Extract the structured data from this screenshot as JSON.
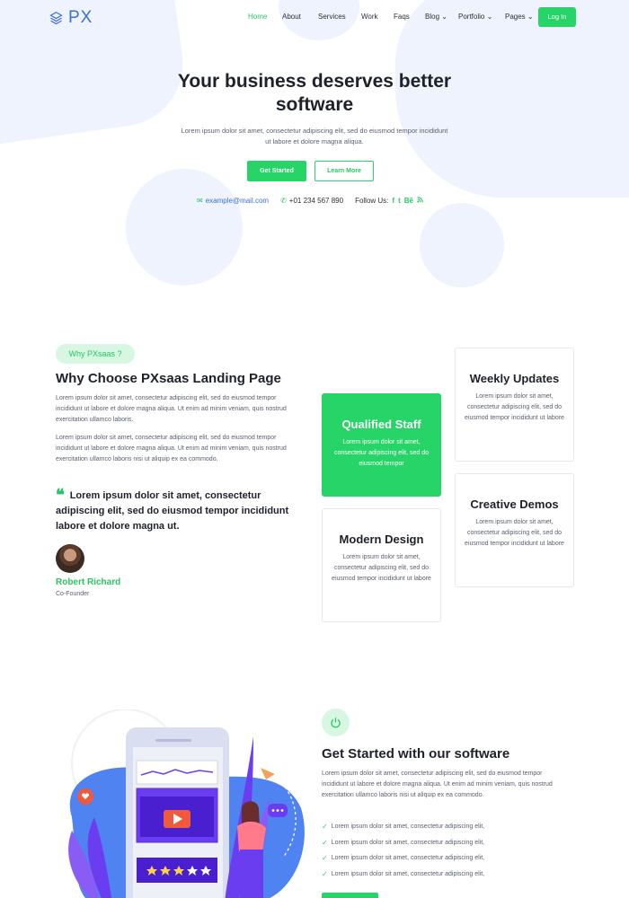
{
  "brand": {
    "logo_text": "PX"
  },
  "nav": {
    "items": [
      "Home",
      "About",
      "Services",
      "Work",
      "Faqs",
      "Blog",
      "Portfolio",
      "Pages"
    ],
    "dropdown_marker": "⌄",
    "login_label": "Log In",
    "active": "Home"
  },
  "hero": {
    "title": "Your business deserves better software",
    "subtitle": "Lorem ipsum dolor sit amet, consectetur adipiscing elit, sed do eiusmod tempor incididunt ut labore et dolore magna aliqua.",
    "primary_button": "Get Started",
    "secondary_button": "Learn More",
    "email": "example@mail.com",
    "phone": "+01 234 567 890",
    "follow_label": "Follow Us:",
    "social": [
      "f",
      "t",
      "Bē",
      "rss"
    ]
  },
  "why": {
    "pill": "Why PXsaas ?",
    "title": "Why Choose PXsaas Landing Page",
    "para1": "Lorem ipsum dolor sit amet, consectetur adipiscing elit, sed do eiusmod tempor incididunt ut labore et dolore magna aliqua. Ut enim ad minim veniam, quis nostrud exercitation ullamco laboris.",
    "para2": "Lorem ipsum dolor sit amet, consectetur adipiscing elit, sed do eiusmod tempor incididunt ut labore et dolore magna aliqua. Ut enim ad minim veniam, quis nostrud exercitation ullamco laboris nisi ut aliquip ex ea commodo.",
    "quote": "Lorem ipsum dolor sit amet, consectetur adipiscing elit, sed do eiusmod tempor incididunt labore et dolore magna ut.",
    "author": "Robert Richard",
    "role": "Co-Founder",
    "cards": {
      "weekly": {
        "title": "Weekly Updates",
        "text": "Lorem ipsum dolor sit amet, consectetur adipiscing elit, sed do eiusmod tempor incididunt ut labore"
      },
      "qualified": {
        "title": "Qualified Staff",
        "text": "Lorem ipsum dolor sit amet, consectetur adipiscing elit, sed do eiusmod tempor"
      },
      "creative": {
        "title": "Creative Demos",
        "text": "Lorem ipsum dolor sit amet, consectetur adipiscing elit, sed do eiusmod tempor incididunt ut labore"
      },
      "modern": {
        "title": "Modern Design",
        "text": "Lorem ipsum dolor sit amet, consectetur adipiscing elit, sed do eiusmod tempor incididunt ut labore"
      }
    }
  },
  "get_started": {
    "title": "Get Started with our software",
    "para": "Lorem ipsum dolor sit amet, consectetur adipiscing elit, sed do eiusmod tempor incididunt ut labore et dolore magna aliqua. Ut enim ad minim veniam, quis nostrud exercitation ullamco laboris nisi ut aliquip ex ea commodo.",
    "checklist": [
      "Lorem ipsum dolor sit amet, consectetur adipiscing elit,",
      "Lorem ipsum dolor sit amet, consectetur adipiscing elit,",
      "Lorem ipsum dolor sit amet, consectetur adipiscing elit,",
      "Lorem ipsum dolor sit amet, consectetur adipiscing elit,"
    ],
    "check_glyph": "✓"
  },
  "colors": {
    "accent": "#27d467",
    "brand_blue": "#3b6fd8",
    "blob": "#eef3fd"
  }
}
